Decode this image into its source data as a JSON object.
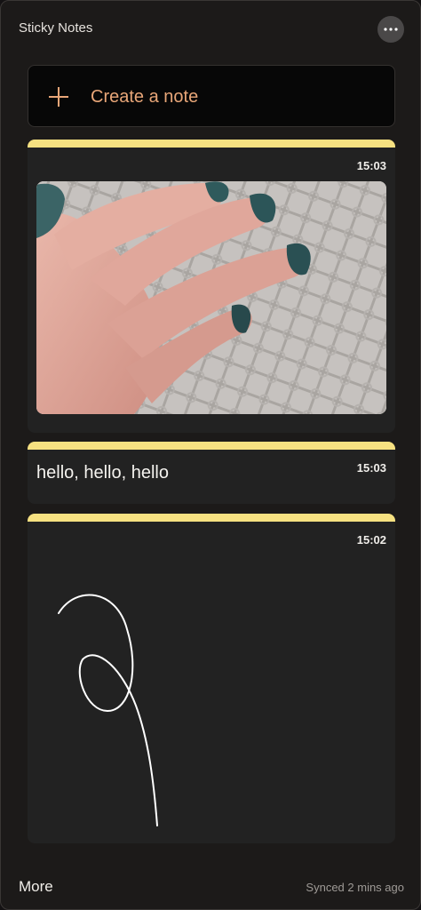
{
  "window": {
    "title": "Sticky Notes"
  },
  "toolbar": {
    "menu_icon": "more-horizontal-icon"
  },
  "create": {
    "label": "Create a note",
    "icon": "plus-icon",
    "accent": "#e8a678"
  },
  "notes": [
    {
      "type": "image",
      "time": "15:03",
      "color": "#f6e181"
    },
    {
      "type": "text",
      "time": "15:03",
      "text": "hello, hello, hello",
      "color": "#f6e181"
    },
    {
      "type": "ink",
      "time": "15:02",
      "color": "#f6e181"
    }
  ],
  "footer": {
    "more_label": "More",
    "sync_status": "Synced 2 mins ago"
  }
}
